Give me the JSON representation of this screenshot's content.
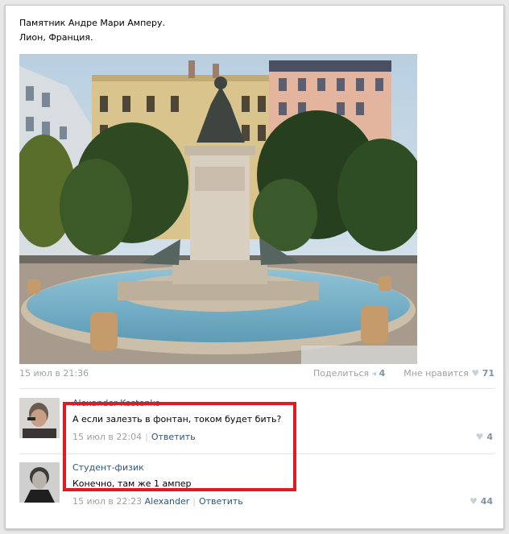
{
  "post": {
    "text_line1": "Памятник Андре Мари Амперу.",
    "text_line2": "Лион, Франция.",
    "date": "15 июл в 21:36",
    "share_label": "Поделиться",
    "share_count": "4",
    "like_label": "Мне нравится",
    "like_count": "71"
  },
  "comments": [
    {
      "author": "Alexander Kostenko",
      "text": "А если залезть в фонтан, током будет бить?",
      "date": "15 июл в 22:04",
      "reply_label": "Ответить",
      "likes": "4"
    },
    {
      "author": "Студент-физик",
      "text": "Конечно, там же 1 ампер",
      "date": "15 июл в 22:23",
      "reply_to": "Alexander",
      "reply_label": "Ответить",
      "likes": "44"
    }
  ],
  "colors": {
    "link": "#2b587a",
    "meta": "#a0a0a0",
    "count": "#7f93a8",
    "highlight": "#e21a1f"
  }
}
